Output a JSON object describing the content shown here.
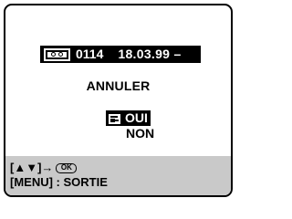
{
  "info": {
    "tape_icon": "tape-cassette-icon",
    "frame_number": "0114",
    "date": "18.03.99 –"
  },
  "dialog": {
    "title": "ANNULER",
    "options": [
      {
        "label": "OUI",
        "selected": true,
        "icon": "pointing-hand-icon"
      },
      {
        "label": "NON",
        "selected": false
      }
    ]
  },
  "guide": {
    "select_prefix": "[▲▼]→",
    "ok_label": "OK",
    "menu_exit": "[MENU] : SORTIE"
  }
}
